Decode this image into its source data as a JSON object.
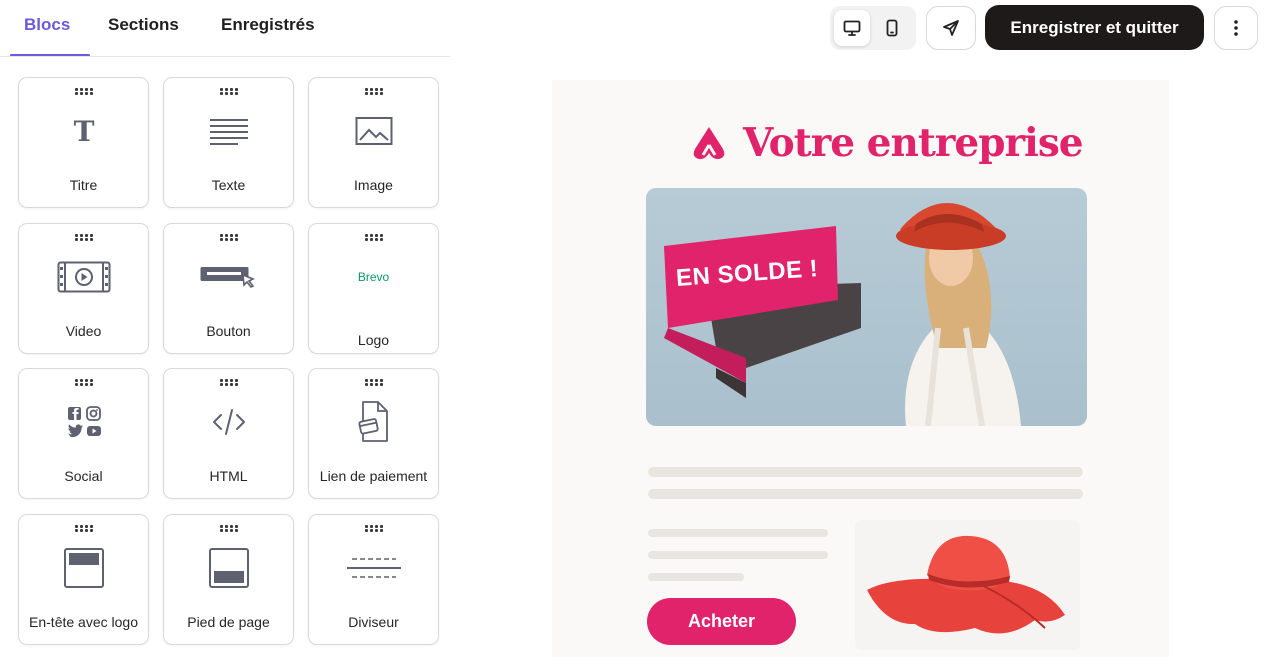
{
  "tabs": [
    {
      "label": "Blocs",
      "active": true
    },
    {
      "label": "Sections",
      "active": false
    },
    {
      "label": "Enregistrés",
      "active": false
    }
  ],
  "toolbar": {
    "desktop_icon": "monitor-icon",
    "mobile_icon": "smartphone-icon",
    "send_icon": "send-icon",
    "save_label": "Enregistrer et quitter",
    "more_icon": "more-vertical-icon"
  },
  "blocks": [
    {
      "label": "Titre",
      "icon": "title-icon"
    },
    {
      "label": "Texte",
      "icon": "text-icon"
    },
    {
      "label": "Image",
      "icon": "image-icon"
    },
    {
      "label": "Video",
      "icon": "video-icon"
    },
    {
      "label": "Bouton",
      "icon": "button-icon"
    },
    {
      "label": "Logo",
      "icon": "logo-icon",
      "logo_text": "Brevo"
    },
    {
      "label": "Social",
      "icon": "social-icon"
    },
    {
      "label": "HTML",
      "icon": "code-icon"
    },
    {
      "label": "Lien de paiement",
      "icon": "payment-link-icon"
    },
    {
      "label": "En-tête avec logo",
      "icon": "header-icon"
    },
    {
      "label": "Pied de page",
      "icon": "footer-icon"
    },
    {
      "label": "Diviseur",
      "icon": "divider-icon"
    }
  ],
  "preview": {
    "brand_name": "Votre entreprise",
    "hero_banner": "EN SOLDE !",
    "button_label": "Acheter",
    "accent_color": "#e0236a"
  }
}
